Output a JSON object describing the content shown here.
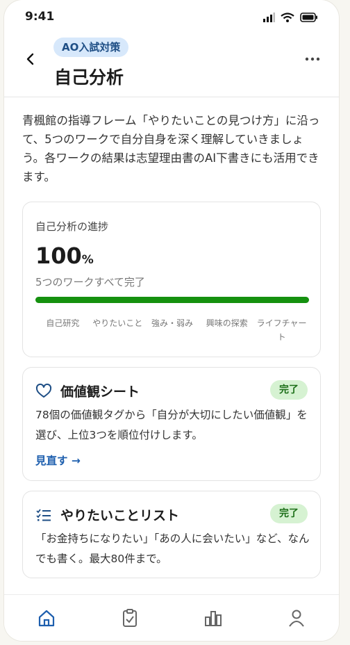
{
  "status_bar": {
    "time": "9:41",
    "icons": [
      "signal-icon",
      "wifi-icon",
      "battery-icon"
    ]
  },
  "header": {
    "badge": "AO入試対策",
    "title": "自己分析",
    "back_icon": "chevron-left-icon",
    "more_icon": "more-horizontal-icon"
  },
  "intro": "青楓館の指導フレーム「やりたいことの見つけ方」に沿って、5つのワークで自分自身を深く理解していきましょう。各ワークの結果は志望理由書のAI下書きにも活用できます。",
  "progress": {
    "label": "自己分析の進捗",
    "value": "100",
    "unit": "%",
    "subtitle": "5つのワークすべて完了",
    "fraction": 1.0,
    "steps": [
      "自己研究",
      "やりたいこと",
      "強み・弱み",
      "興味の探索",
      "ライフチャート"
    ]
  },
  "works": [
    {
      "icon": "heart-icon",
      "title": "価値観シート",
      "status": "完了",
      "description": "78個の価値観タグから「自分が大切にしたい価値観」を選び、上位3つを順位付けします。",
      "link": "見直す →"
    },
    {
      "icon": "checklist-icon",
      "title": "やりたいことリスト",
      "status": "完了",
      "description": "「お金持ちになりたい」「あの人に会いたい」など、なんでも書く。最大80件まで。"
    }
  ],
  "bottom_nav": {
    "items": [
      "home-icon",
      "clipboard-check-icon",
      "bar-chart-icon",
      "user-icon"
    ],
    "active_index": 0
  },
  "colors": {
    "accent": "#1e5fae",
    "badge_bg": "#d7e8fb",
    "done_bg": "#d6f2d2",
    "done_text": "#1b6e17",
    "progress": "#15910f"
  }
}
